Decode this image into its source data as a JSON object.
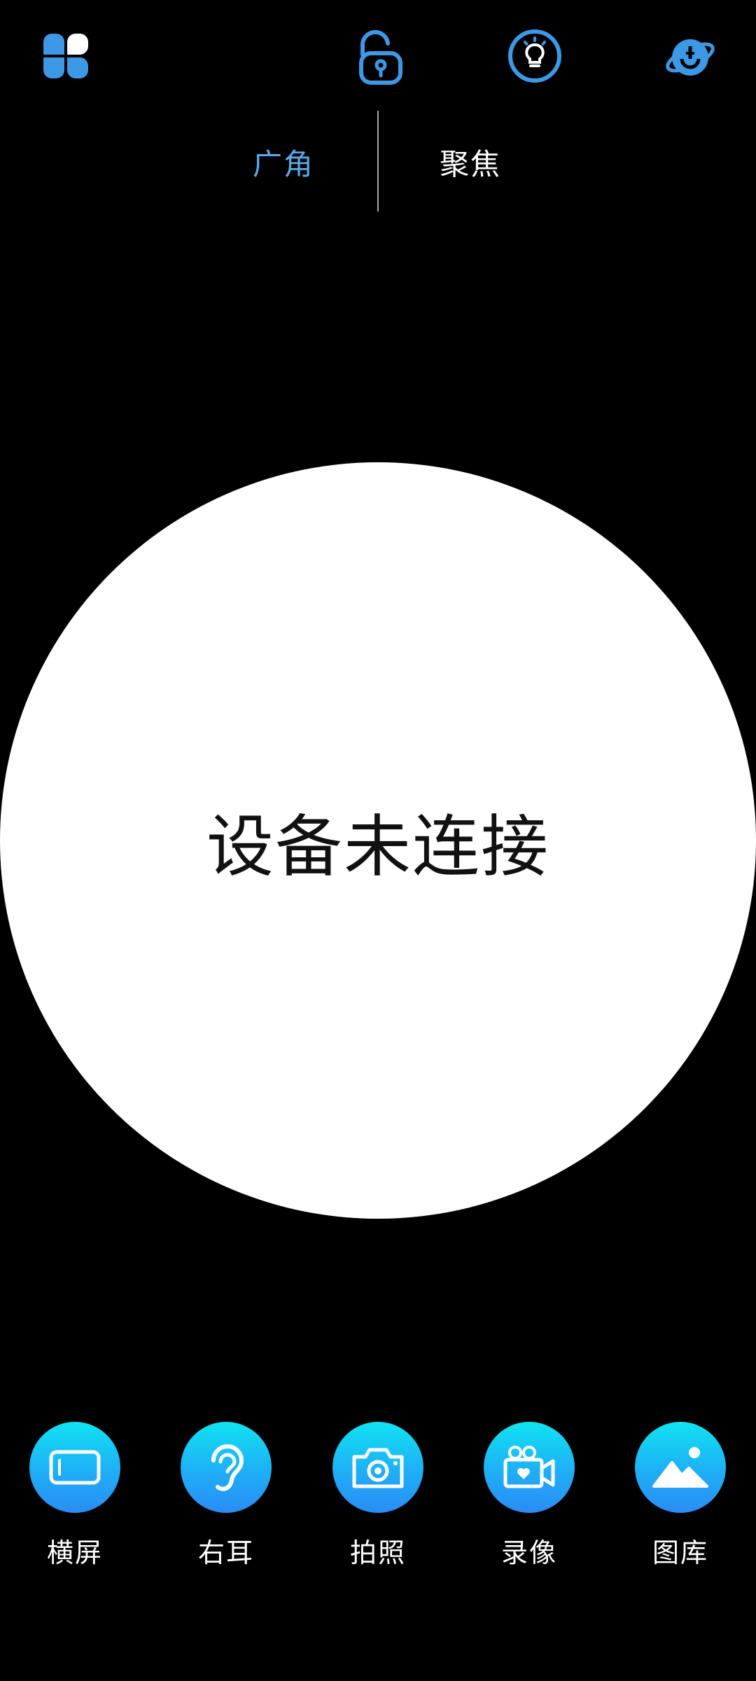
{
  "header": {
    "icons": [
      "grid-icon",
      "unlock-icon",
      "lightbulb-icon",
      "gyro-icon"
    ]
  },
  "mode_tabs": [
    {
      "label": "广角",
      "color": "#5aa8e8",
      "active": true
    },
    {
      "label": "聚焦",
      "color": "#ffffff",
      "active": false
    }
  ],
  "preview": {
    "status": "设备未连接"
  },
  "actions": [
    {
      "label": "横屏",
      "icon": "landscape-icon"
    },
    {
      "label": "右耳",
      "icon": "ear-icon"
    },
    {
      "label": "拍照",
      "icon": "camera-icon"
    },
    {
      "label": "录像",
      "icon": "video-icon"
    },
    {
      "label": "图库",
      "icon": "gallery-icon"
    }
  ],
  "colors": {
    "accent": "#3d98e6",
    "button_gradient_top": "#10e3f2",
    "button_gradient_bottom": "#2a8cf5",
    "background": "#000000"
  }
}
